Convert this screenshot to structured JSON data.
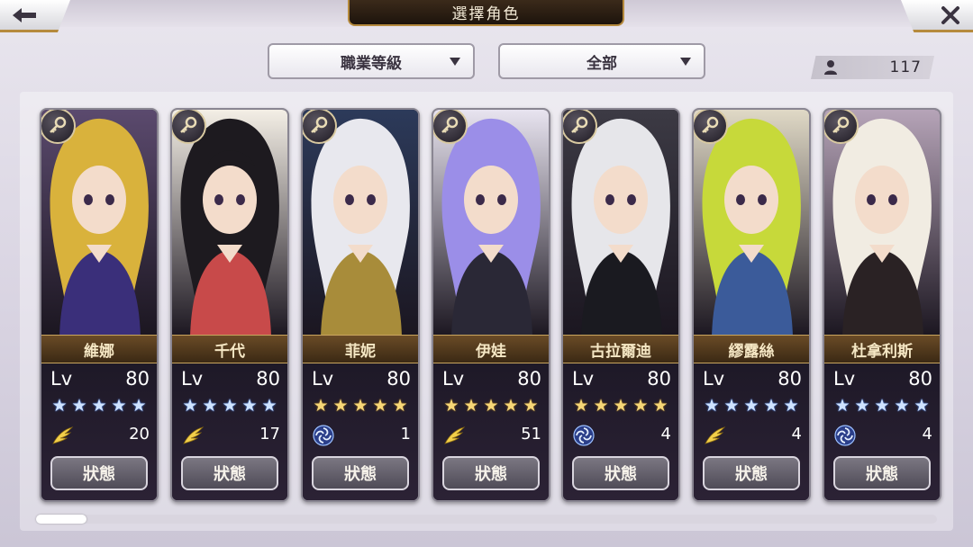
{
  "header": {
    "title": "選擇角色",
    "back_icon": "back-arrow-icon",
    "close_icon": "close-icon"
  },
  "filters": {
    "class_rank": "職業等級",
    "all": "全部"
  },
  "character_count": "117",
  "status_label": "狀態",
  "lv_label": "Lv",
  "characters": [
    {
      "name": "維娜",
      "level": "80",
      "stars": 5,
      "star_color": "blue",
      "type": "wing",
      "value": "20",
      "hair": "#d9b23c",
      "bg": "#5b4a6e",
      "outfit": "#3a2f7a"
    },
    {
      "name": "千代",
      "level": "80",
      "stars": 5,
      "star_color": "blue",
      "type": "wing",
      "value": "17",
      "hair": "#1d1a1f",
      "bg": "#f4efe6",
      "outfit": "#c84a4a"
    },
    {
      "name": "菲妮",
      "level": "80",
      "stars": 5,
      "star_color": "gold",
      "type": "swirl",
      "value": "1",
      "hair": "#e8e8ee",
      "bg": "#2c3a5a",
      "outfit": "#a88c3a"
    },
    {
      "name": "伊娃",
      "level": "80",
      "stars": 5,
      "star_color": "gold",
      "type": "wing",
      "value": "51",
      "hair": "#9b8ee8",
      "bg": "#e8e4f0",
      "outfit": "#2a2836"
    },
    {
      "name": "古拉爾迪",
      "level": "80",
      "stars": 5,
      "star_color": "gold",
      "type": "swirl",
      "value": "4",
      "hair": "#e6e6ea",
      "bg": "#3c3a44",
      "outfit": "#1a1a20"
    },
    {
      "name": "繆露絲",
      "level": "80",
      "stars": 5,
      "star_color": "blue",
      "type": "wing",
      "value": "4",
      "hair": "#c7d93a",
      "bg": "#e0d9c6",
      "outfit": "#3b5b9a"
    },
    {
      "name": "杜拿利斯",
      "level": "80",
      "stars": 5,
      "star_color": "blue",
      "type": "swirl",
      "value": "4",
      "hair": "#f1ece2",
      "bg": "#b6a4b8",
      "outfit": "#2a2224"
    }
  ],
  "scroll_position": 0.0
}
